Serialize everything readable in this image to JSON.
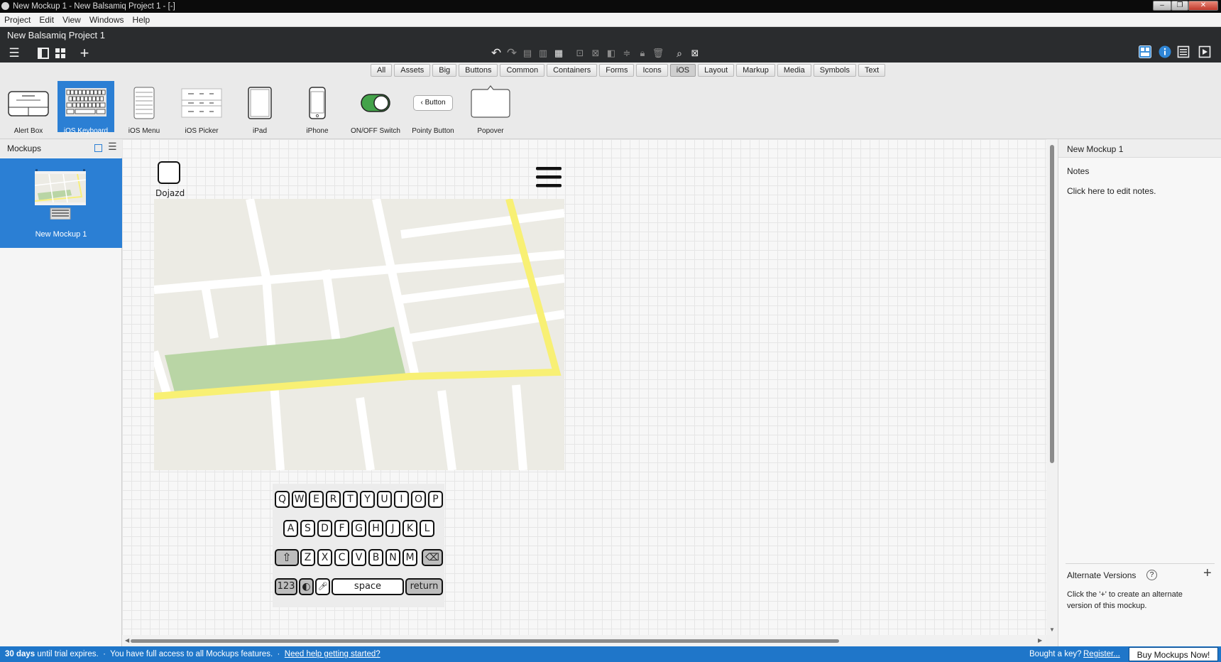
{
  "window": {
    "title": "New Mockup 1 - New Balsamiq Project 1 - [-]"
  },
  "menu": [
    "Project",
    "Edit",
    "View",
    "Windows",
    "Help"
  ],
  "project": {
    "name": "New Balsamiq Project 1"
  },
  "filters": {
    "tabs": [
      "All",
      "Assets",
      "Big",
      "Buttons",
      "Common",
      "Containers",
      "Forms",
      "Icons",
      "iOS",
      "Layout",
      "Markup",
      "Media",
      "Symbols",
      "Text"
    ],
    "selected": "iOS"
  },
  "library": {
    "items": [
      "Alert Box",
      "iOS Keyboard",
      "iOS Menu",
      "iOS Picker",
      "iPad",
      "iPhone",
      "ON/OFF Switch",
      "Pointy Button",
      "Popover"
    ],
    "selected": "iOS Keyboard",
    "pointy_button_text": "Button"
  },
  "mockups": {
    "header": "Mockups",
    "items": [
      "New Mockup 1"
    ]
  },
  "canvas": {
    "app_label": "Dojazd",
    "keyboard": {
      "row1": [
        "Q",
        "W",
        "E",
        "R",
        "T",
        "Y",
        "U",
        "I",
        "O",
        "P"
      ],
      "row2": [
        "A",
        "S",
        "D",
        "F",
        "G",
        "H",
        "J",
        "K",
        "L"
      ],
      "row3": [
        "Z",
        "X",
        "C",
        "V",
        "B",
        "N",
        "M"
      ],
      "numbers": "123",
      "space": "space",
      "return": "return"
    }
  },
  "right_panel": {
    "mockup_name": "New Mockup 1",
    "notes_label": "Notes",
    "notes_placeholder": "Click here to edit notes.",
    "alternate_versions": "Alternate Versions",
    "alternate_help": "?",
    "alternate_hint_1": "Click the '+' to create an alternate",
    "alternate_hint_2": "version of this mockup."
  },
  "status": {
    "days": "30 days",
    "trial_text": " until trial expires.  ·  You have full access to all Mockups features.  ·  ",
    "help_link": "Need help getting started?",
    "bought": "Bought a key?",
    "register": "Register...",
    "buy_button": "Buy Mockups Now!"
  }
}
